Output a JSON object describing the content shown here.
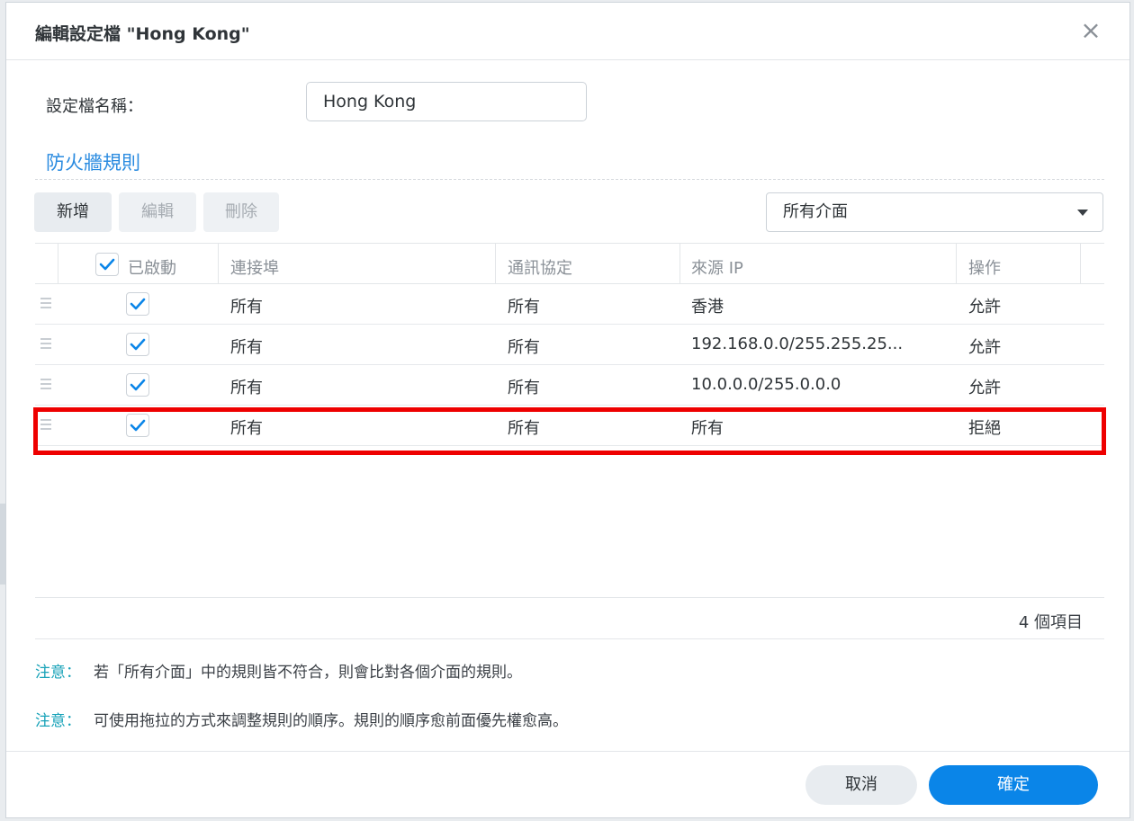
{
  "dialog": {
    "title": "編輯設定檔 \"Hong Kong\"",
    "close_icon": "close-icon"
  },
  "profile": {
    "label": "設定檔名稱：",
    "value": "Hong Kong"
  },
  "section_title": "防火牆規則",
  "toolbar": {
    "add_label": "新增",
    "edit_label": "編輯",
    "delete_label": "刪除",
    "interface_selected": "所有介面"
  },
  "table": {
    "headers": {
      "enabled": "已啟動",
      "port": "連接埠",
      "protocol": "通訊協定",
      "source_ip": "來源 IP",
      "action": "操作"
    },
    "rows": [
      {
        "enabled": true,
        "port": "所有",
        "protocol": "所有",
        "source_ip": "香港",
        "action": "允許"
      },
      {
        "enabled": true,
        "port": "所有",
        "protocol": "所有",
        "source_ip": "192.168.0.0/255.255.25...",
        "action": "允許"
      },
      {
        "enabled": true,
        "port": "所有",
        "protocol": "所有",
        "source_ip": "10.0.0.0/255.0.0.0",
        "action": "允許"
      },
      {
        "enabled": true,
        "port": "所有",
        "protocol": "所有",
        "source_ip": "所有",
        "action": "拒絕"
      }
    ]
  },
  "item_count": "4 個項目",
  "notes": [
    {
      "label": "注意：",
      "text": "若「所有介面」中的規則皆不符合，則會比對各個介面的規則。"
    },
    {
      "label": "注意：",
      "text": "可使用拖拉的方式來調整規則的順序。規則的順序愈前面優先權愈高。"
    }
  ],
  "buttons": {
    "cancel_label": "取消",
    "ok_label": "確定"
  },
  "colors": {
    "accent": "#0a85e8",
    "section_title": "#2a8be0",
    "note_label": "#17a2b8",
    "highlight": "#ee0000"
  }
}
